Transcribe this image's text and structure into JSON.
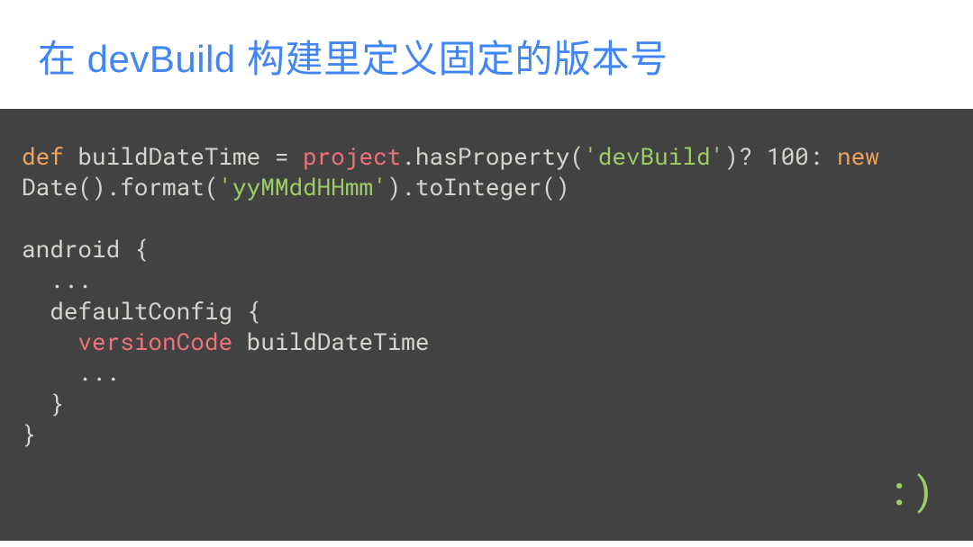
{
  "header": {
    "title": "在 devBuild 构建里定义固定的版本号"
  },
  "code": {
    "tokens": [
      {
        "text": "def",
        "class": "kw-orange"
      },
      {
        "text": " buildDateTime = ",
        "class": ""
      },
      {
        "text": "project",
        "class": "kw-red"
      },
      {
        "text": ".hasProperty(",
        "class": ""
      },
      {
        "text": "'devBuild'",
        "class": "kw-green"
      },
      {
        "text": ")? 100: ",
        "class": ""
      },
      {
        "text": "new",
        "class": "kw-orange"
      },
      {
        "text": " Date().format(",
        "class": ""
      },
      {
        "text": "'yyMMddHHmm'",
        "class": "kw-green"
      },
      {
        "text": ").toInteger()\n\nandroid {\n  ...\n  defaultConfig {\n    ",
        "class": ""
      },
      {
        "text": "versionCode",
        "class": "kw-red"
      },
      {
        "text": " buildDateTime\n    ...\n  }\n}",
        "class": ""
      }
    ]
  },
  "footer": {
    "smiley": ":)"
  }
}
